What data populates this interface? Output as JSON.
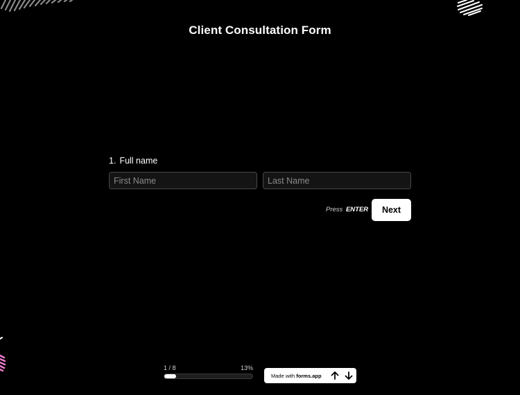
{
  "form": {
    "title": "Client Consultation Form"
  },
  "question": {
    "number": "1.",
    "label": "Full name",
    "first_name_placeholder": "First Name",
    "last_name_placeholder": "Last Name",
    "first_name_value": "",
    "last_name_value": ""
  },
  "actions": {
    "press_prefix": "Press",
    "press_key": "ENTER",
    "next_label": "Next"
  },
  "progress": {
    "count_text": "1 / 8",
    "percent_text": "13%",
    "fraction": 0.13
  },
  "badge": {
    "made_with": "Made with",
    "brand": "forms.app",
    "up_icon": "arrow-up-icon",
    "down_icon": "arrow-down-icon"
  },
  "colors": {
    "background": "#000000",
    "accent": "#ffffff",
    "decoration_pink": "#f07ad0"
  }
}
